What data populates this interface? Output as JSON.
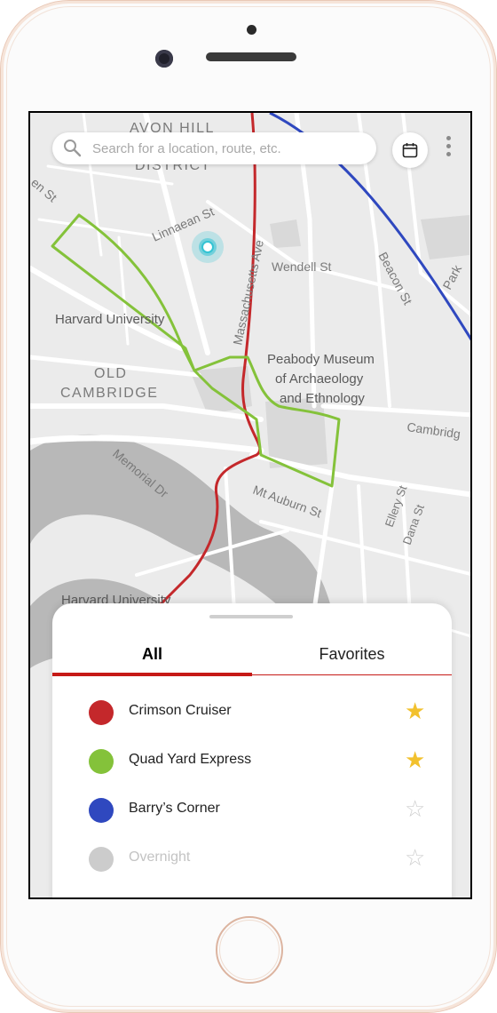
{
  "device": {
    "type": "smartphone-frame"
  },
  "map": {
    "labels": {
      "avon_hill": "AVON HILL",
      "district": "DISTRICT",
      "linnaean": "Linnaean St",
      "mass_ave": "Massachusetts Ave",
      "wendell": "Wendell St",
      "harvard_university": "Harvard University",
      "harvard_university_south": "Harvard University",
      "old": "OLD",
      "cambridge": "CAMBRIDGE",
      "peabody_1": "Peabody Museum",
      "peabody_2": "of Archaeology",
      "peabody_3": "and Ethnology",
      "cambridge_st": "Cambridg",
      "memorial": "Memorial Dr",
      "mt_auburn": "Mt Auburn St",
      "ellery": "Ellery St",
      "dana": "Dana St",
      "beacon": "Beacon St",
      "park": "Park",
      "en_st": "en St"
    },
    "current_location_color": "#34c3d3"
  },
  "search": {
    "placeholder": "Search for a location, route, etc.",
    "value": ""
  },
  "toolbar": {
    "calendar_icon": "calendar-icon",
    "more_icon": "kebab-menu-icon"
  },
  "tabs": {
    "all": "All",
    "favorites": "Favorites",
    "active": "All",
    "accent": "#c61a17"
  },
  "routes": [
    {
      "name": "Crimson Cruiser",
      "color": "#c4282b",
      "favorite": true,
      "active": true
    },
    {
      "name": "Quad Yard Express",
      "color": "#84c23a",
      "favorite": true,
      "active": true
    },
    {
      "name": "Barry’s Corner",
      "color": "#2f48bf",
      "favorite": false,
      "active": true
    },
    {
      "name": "Overnight",
      "color": "#cccccc",
      "favorite": false,
      "active": false
    }
  ],
  "star_glyphs": {
    "on": "★",
    "off": "☆"
  }
}
